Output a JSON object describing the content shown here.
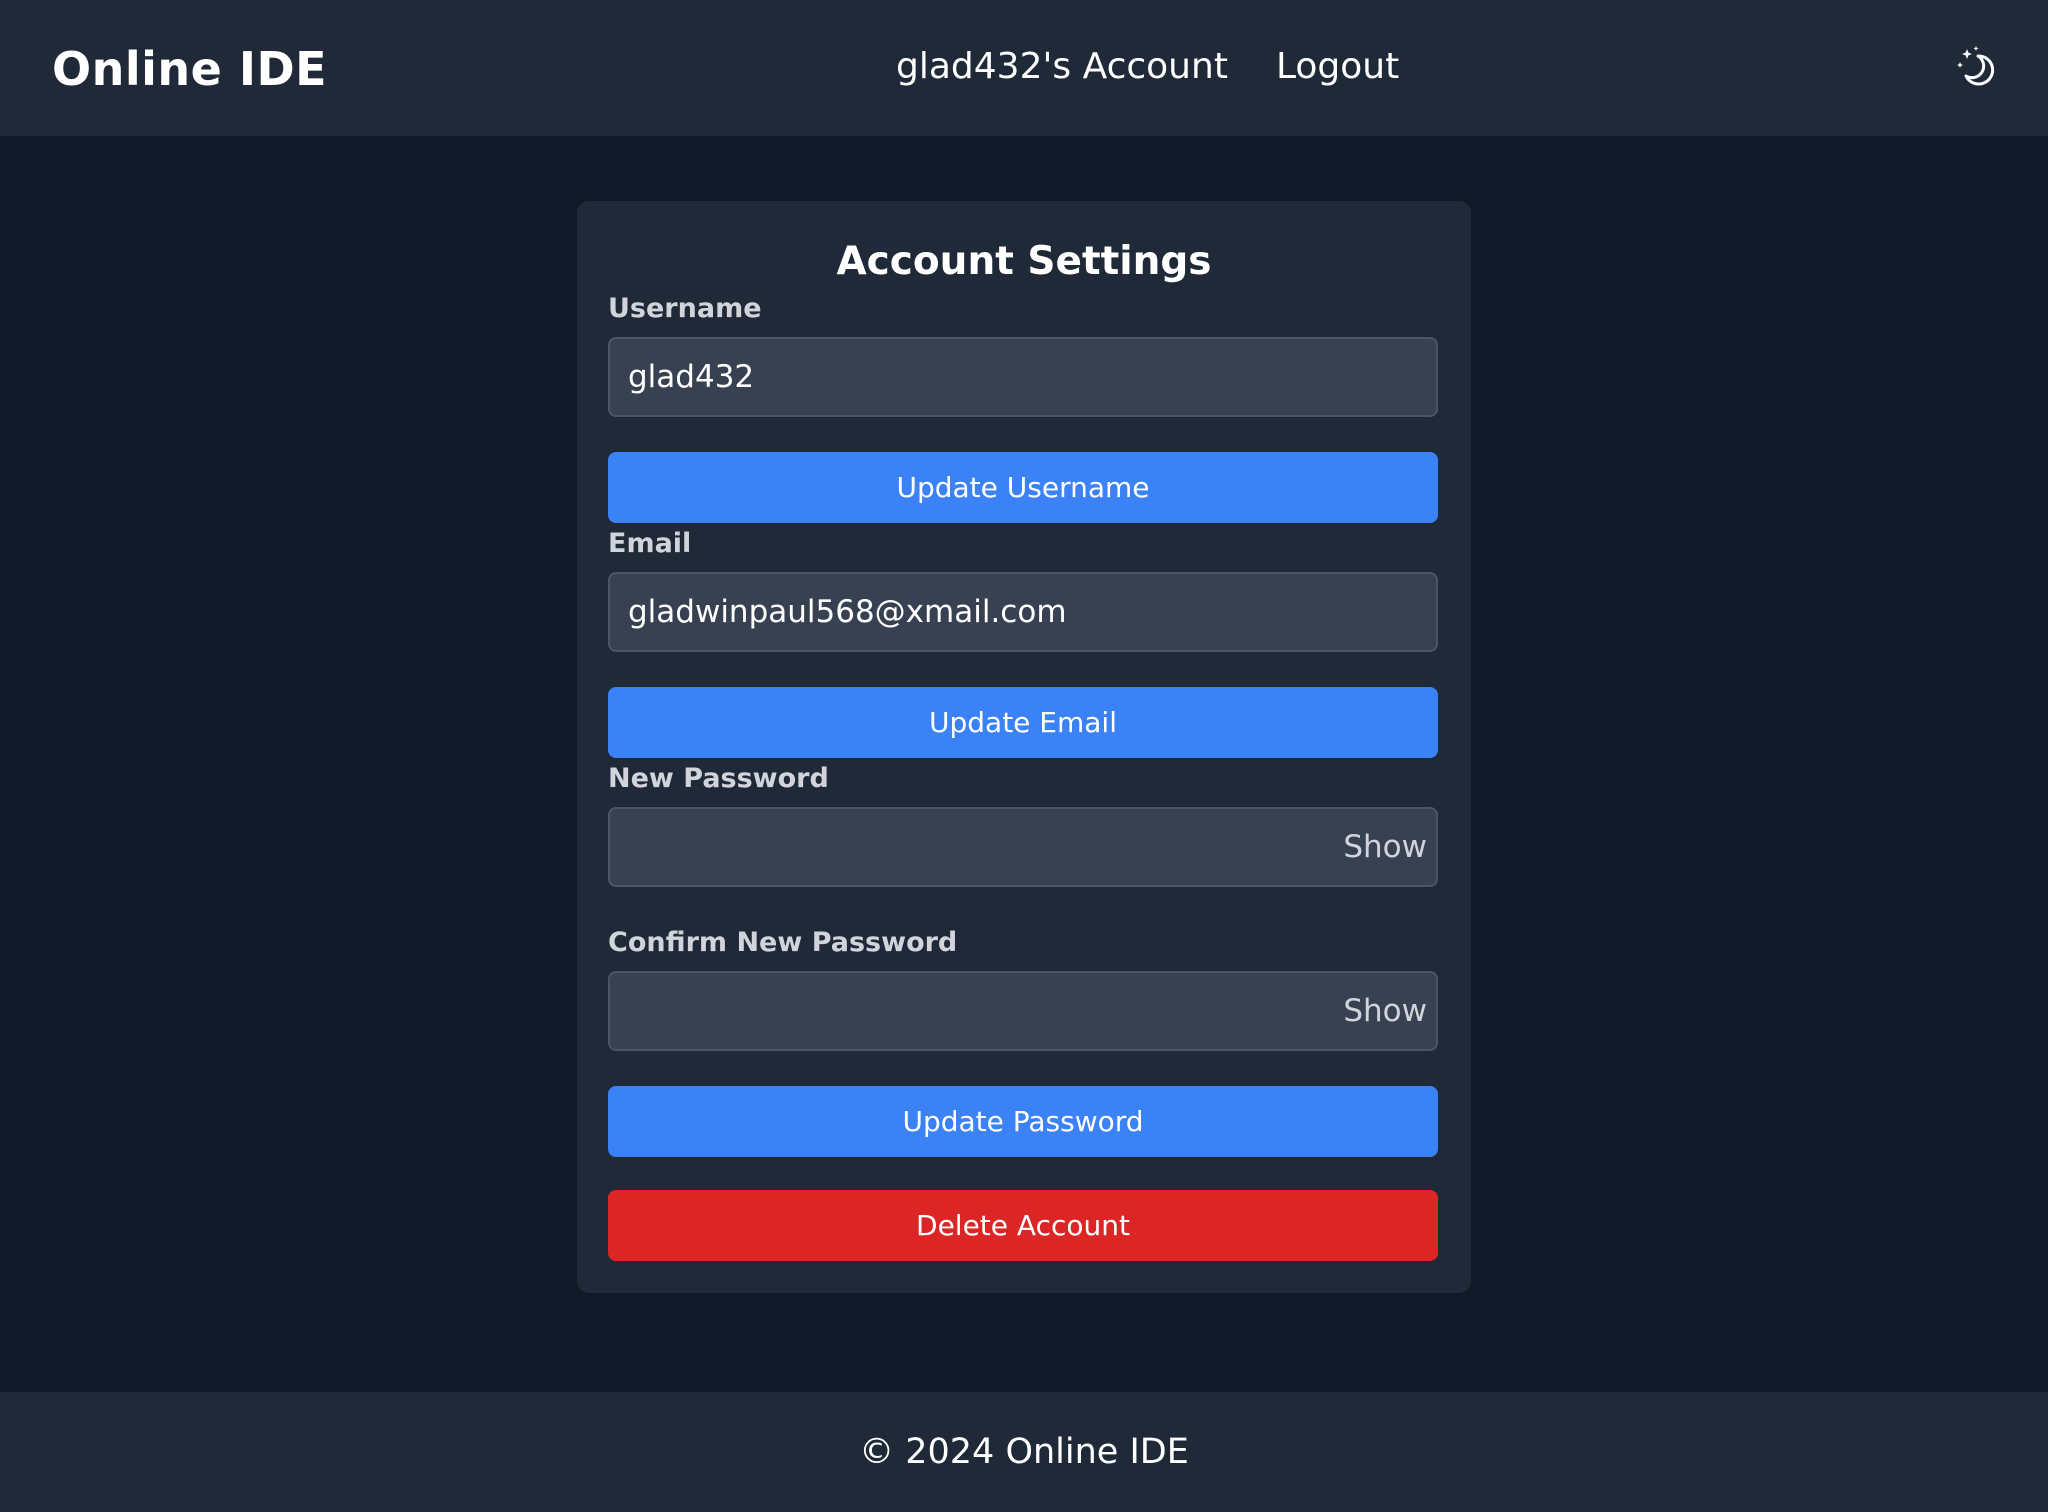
{
  "header": {
    "brand": "Online IDE",
    "nav": {
      "account": "glad432's Account",
      "logout": "Logout"
    },
    "theme_icon": "moon-stars-icon"
  },
  "settings": {
    "title": "Account Settings",
    "username": {
      "label": "Username",
      "value": "glad432",
      "button": "Update Username"
    },
    "email": {
      "label": "Email",
      "value": "gladwinpaul568@xmail.com",
      "button": "Update Email"
    },
    "new_password": {
      "label": "New Password",
      "value": "",
      "toggle": "Show"
    },
    "confirm_password": {
      "label": "Confirm New Password",
      "value": "",
      "toggle": "Show"
    },
    "update_password_button": "Update Password",
    "delete_button": "Delete Account"
  },
  "footer": {
    "text": "© 2024 Online IDE"
  },
  "colors": {
    "page_bg": "#111827",
    "panel_bg": "#1f2937",
    "input_bg": "#374151",
    "primary": "#3b82f6",
    "danger": "#dc2626"
  }
}
